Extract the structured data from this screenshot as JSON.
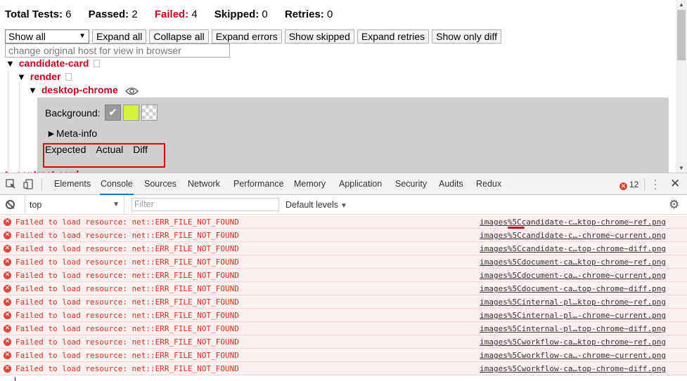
{
  "summary": {
    "total_label": "Total Tests:",
    "total_value": "6",
    "passed_label": "Passed:",
    "passed_value": "2",
    "failed_label": "Failed:",
    "failed_value": "4",
    "skipped_label": "Skipped:",
    "skipped_value": "0",
    "retries_label": "Retries:",
    "retries_value": "0"
  },
  "controls": {
    "view_select": "Show all",
    "expand_all": "Expand all",
    "collapse_all": "Collapse all",
    "expand_errors": "Expand errors",
    "show_skipped": "Show skipped",
    "expand_retries": "Expand retries",
    "show_only_diff": "Show only diff",
    "host_placeholder": "change original host for view in browser"
  },
  "tree": {
    "suite": "candidate-card",
    "state": "render",
    "browser": "desktop-chrome",
    "background_label": "Background:",
    "meta_info": "Meta-info",
    "image_tabs": [
      "Expected",
      "Actual",
      "Diff"
    ],
    "next_suite_cut": "contract-card"
  },
  "devtools": {
    "tabs": [
      "Elements",
      "Console",
      "Sources",
      "Network",
      "Performance",
      "Memory",
      "Application",
      "Security",
      "Audits",
      "Redux"
    ],
    "active_tab": "Console",
    "error_count": "12",
    "context": "top",
    "filter_placeholder": "Filter",
    "levels": "Default levels"
  },
  "console": {
    "message": "Failed to load resource: net::ERR_FILE_NOT_FOUND",
    "sources": [
      "images%5Ccandidate-c…ktop-chrome~ref.png",
      "images%5Ccandidate-c…-chrome~current.png",
      "images%5Ccandidate-c…top-chrome~diff.png",
      "images%5Cdocument-ca…ktop-chrome~ref.png",
      "images%5Cdocument-ca…-chrome~current.png",
      "images%5Cdocument-ca…top-chrome~diff.png",
      "images%5Cinternal-pl…ktop-chrome~ref.png",
      "images%5Cinternal-pl…-chrome~current.png",
      "images%5Cinternal-pl…top-chrome~diff.png",
      "images%5Cworkflow-ca…ktop-chrome~ref.png",
      "images%5Cworkflow-ca…-chrome~current.png",
      "images%5Cworkflow-ca…top-chrome~diff.png"
    ]
  },
  "colors": {
    "failed": "#c8001e",
    "error_text": "#e0301e",
    "error_bg": "#fdf0f0",
    "highlight_box": "#d40000",
    "active_tab": "#1a73e8"
  }
}
